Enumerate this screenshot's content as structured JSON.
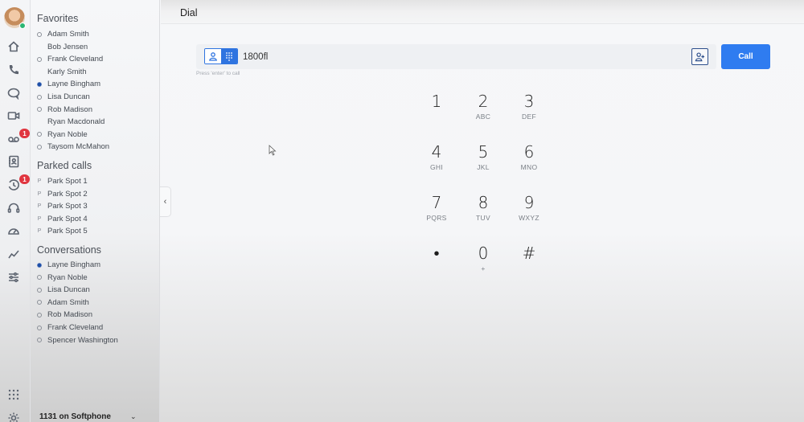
{
  "header": {
    "title": "Dial"
  },
  "rail": {
    "icons": [
      {
        "name": "home-icon"
      },
      {
        "name": "phone-icon"
      },
      {
        "name": "chat-icon"
      },
      {
        "name": "video-icon"
      },
      {
        "name": "voicemail-icon",
        "badge": "1"
      },
      {
        "name": "contacts-icon"
      },
      {
        "name": "history-icon",
        "badge": "1"
      },
      {
        "name": "headset-icon"
      },
      {
        "name": "dashboard-icon"
      },
      {
        "name": "analytics-icon"
      },
      {
        "name": "settings-sliders-icon"
      }
    ],
    "bottom_icons": [
      {
        "name": "apps-grid-icon"
      },
      {
        "name": "gear-icon"
      }
    ]
  },
  "sidebar": {
    "favorites": {
      "title": "Favorites",
      "items": [
        {
          "label": "Adam Smith",
          "status": "offline"
        },
        {
          "label": "Bob Jensen",
          "status": "none"
        },
        {
          "label": "Frank Cleveland",
          "status": "offline"
        },
        {
          "label": "Karly Smith",
          "status": "none"
        },
        {
          "label": "Layne Bingham",
          "status": "busy"
        },
        {
          "label": "Lisa Duncan",
          "status": "offline"
        },
        {
          "label": "Rob Madison",
          "status": "offline"
        },
        {
          "label": "Ryan Macdonald",
          "status": "none"
        },
        {
          "label": "Ryan Noble",
          "status": "offline"
        },
        {
          "label": "Taysom McMahon",
          "status": "offline"
        }
      ]
    },
    "parked": {
      "title": "Parked calls",
      "marker": "P",
      "items": [
        {
          "label": "Park Spot 1"
        },
        {
          "label": "Park Spot 2"
        },
        {
          "label": "Park Spot 3"
        },
        {
          "label": "Park Spot 4"
        },
        {
          "label": "Park Spot 5"
        }
      ]
    },
    "conversations": {
      "title": "Conversations",
      "items": [
        {
          "label": "Layne Bingham",
          "status": "busy"
        },
        {
          "label": "Ryan Noble",
          "status": "offline"
        },
        {
          "label": "Lisa Duncan",
          "status": "offline"
        },
        {
          "label": "Adam Smith",
          "status": "offline"
        },
        {
          "label": "Rob Madison",
          "status": "offline"
        },
        {
          "label": "Frank Cleveland",
          "status": "offline"
        },
        {
          "label": "Spencer Washington",
          "status": "offline"
        }
      ]
    },
    "footer": {
      "label": "1131 on Softphone",
      "chevron": "⌄"
    },
    "collapse_glyph": "‹"
  },
  "dial": {
    "input_value": "1800fl",
    "hint": "Press 'enter' to call",
    "call_label": "Call",
    "accent": "#2f7cf0",
    "keys": [
      {
        "digit": "1",
        "letters": ""
      },
      {
        "digit": "2",
        "letters": "ABC"
      },
      {
        "digit": "3",
        "letters": "DEF"
      },
      {
        "digit": "4",
        "letters": "GHI"
      },
      {
        "digit": "5",
        "letters": "JKL"
      },
      {
        "digit": "6",
        "letters": "MNO"
      },
      {
        "digit": "7",
        "letters": "PQRS"
      },
      {
        "digit": "8",
        "letters": "TUV"
      },
      {
        "digit": "9",
        "letters": "WXYZ"
      },
      {
        "digit": "•",
        "letters": ""
      },
      {
        "digit": "0",
        "letters": "+"
      },
      {
        "digit": "#",
        "letters": ""
      }
    ]
  }
}
